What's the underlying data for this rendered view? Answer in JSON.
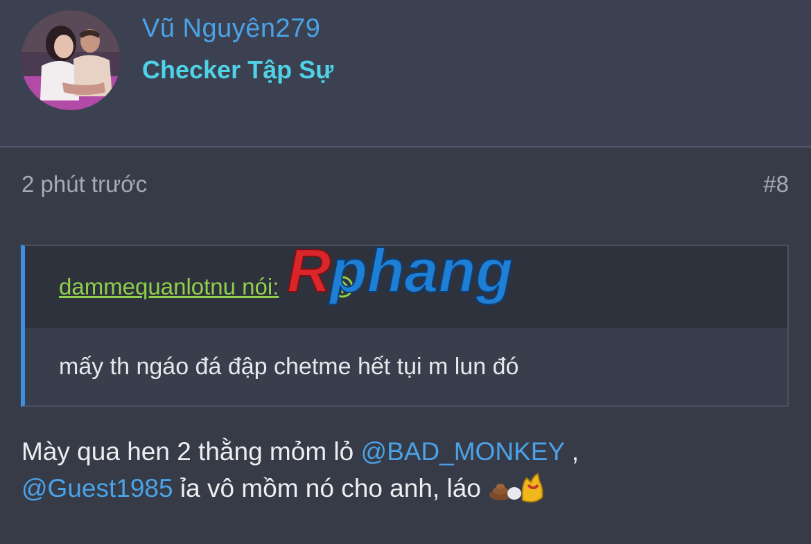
{
  "user": {
    "username": "Vũ Nguyên279",
    "title": "Checker Tập Sự"
  },
  "post": {
    "time": "2 phút trước",
    "number": "#8"
  },
  "quote": {
    "author": "dammequanlotnu nói:",
    "body": "mấy th ngáo đá đập chetme hết tụi m lun đó"
  },
  "message": {
    "part1": "Mày qua hen 2 thằng mỏm lỏ ",
    "mention1": "@BAD_MONKEY",
    "part2": " ,",
    "mention2": "@Guest1985",
    "part3": " ỉa vô mồm nó cho anh, láo "
  },
  "watermark": {
    "text": "Rphang"
  },
  "colors": {
    "background": "#363b47",
    "mention": "#4aa3e8",
    "user_title": "#4fd1e6",
    "quote_author": "#8fcf4a",
    "quote_bar": "#3d8fe0"
  },
  "icons": {
    "jump": "arrow-up-circle-icon",
    "emoji": "poop-and-money-bag-emoji-icon"
  }
}
